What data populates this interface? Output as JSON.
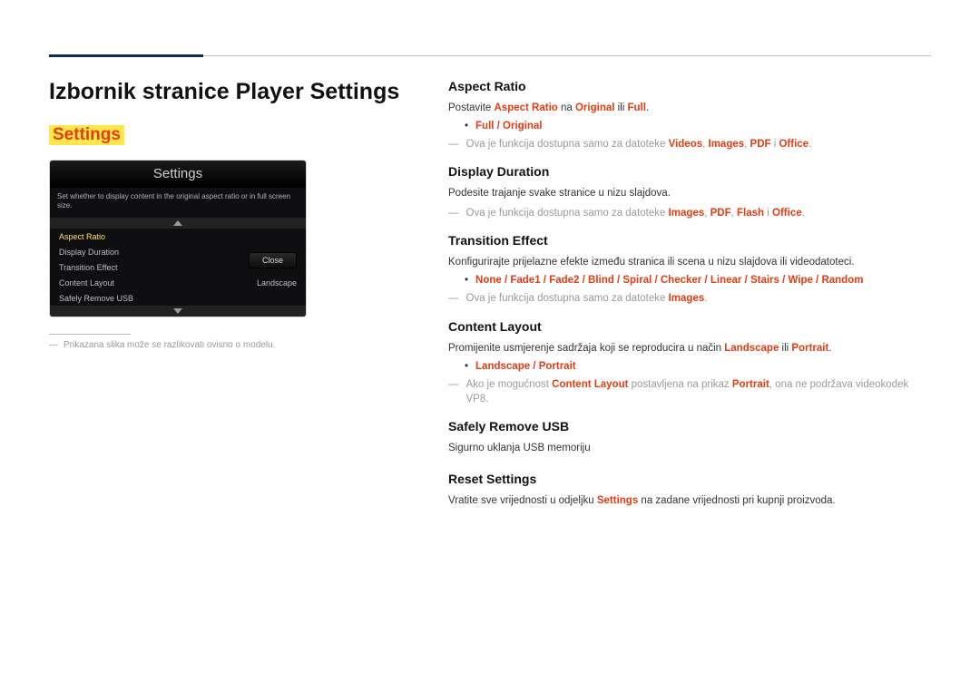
{
  "page_title": "Izbornik stranice Player Settings",
  "subheading": "Settings",
  "screenshot": {
    "title": "Settings",
    "desc": "Set whether to display content in the original aspect ratio or in full screen size.",
    "rows": [
      {
        "label": "Aspect Ratio",
        "value": ""
      },
      {
        "label": "Display Duration",
        "value": ""
      },
      {
        "label": "Transition Effect",
        "value": ""
      },
      {
        "label": "Content Layout",
        "value": "Landscape"
      },
      {
        "label": "Safely Remove USB",
        "value": ""
      }
    ],
    "close": "Close"
  },
  "footnote": "Prikazana slika može se razlikovati ovisno o modelu.",
  "sections": {
    "aspect": {
      "title": "Aspect Ratio",
      "line1_a": "Postavite ",
      "line1_b": "Aspect Ratio",
      "line1_c": " na ",
      "line1_d": "Original",
      "line1_e": " ili ",
      "line1_f": "Full",
      "line1_g": ".",
      "bullet": "Full / Original",
      "note_pre": "Ova je funkcija dostupna samo za datoteke ",
      "note_a": "Videos",
      "note_b": "Images",
      "note_c": "PDF",
      "note_d": "Office",
      "note_sep1": ", ",
      "note_sep2": ", ",
      "note_sep3": " i ",
      "note_end": "."
    },
    "display": {
      "title": "Display Duration",
      "line1": "Podesite trajanje svake stranice u nizu slajdova.",
      "note_pre": "Ova je funkcija dostupna samo za datoteke ",
      "note_a": "Images",
      "note_b": "PDF",
      "note_c": "Flash",
      "note_d": "Office",
      "note_sep1": ", ",
      "note_sep2": ", ",
      "note_sep3": " i ",
      "note_end": "."
    },
    "transition": {
      "title": "Transition Effect",
      "line1": "Konfigurirajte prijelazne efekte između stranica ili scena u nizu slajdova ili videodatoteci.",
      "bullet": "None / Fade1 / Fade2 / Blind / Spiral / Checker / Linear / Stairs / Wipe / Random",
      "note_pre": "Ova je funkcija dostupna samo za datoteke ",
      "note_a": "Images",
      "note_end": "."
    },
    "content": {
      "title": "Content Layout",
      "line1_a": "Promijenite usmjerenje sadržaja koji se reproducira u način ",
      "line1_b": "Landscape",
      "line1_c": " ili ",
      "line1_d": "Portrait",
      "line1_e": ".",
      "bullet": "Landscape / Portrait",
      "note_a": "Ako je mogućnost ",
      "note_b": "Content Layout",
      "note_c": " postavljena na prikaz ",
      "note_d": "Portrait",
      "note_e": ", ona ne podržava videokodek VP8."
    },
    "safely": {
      "title": "Safely Remove USB",
      "line1": "Sigurno uklanja USB memoriju"
    },
    "reset": {
      "title": "Reset Settings",
      "line1_a": "Vratite sve vrijednosti u odjeljku ",
      "line1_b": "Settings",
      "line1_c": " na zadane vrijednosti pri kupnji proizvoda."
    }
  }
}
